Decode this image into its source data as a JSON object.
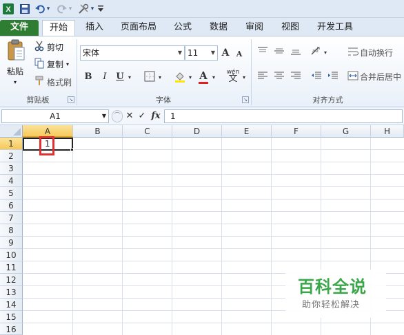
{
  "qat": {
    "excel_icon": "X",
    "undo_arrow": "▾",
    "redo_arrow": "▾",
    "customize": "₹"
  },
  "tabs": [
    "文件",
    "开始",
    "插入",
    "页面布局",
    "公式",
    "数据",
    "审阅",
    "视图",
    "开发工具"
  ],
  "ribbon": {
    "clipboard": {
      "paste": "粘贴",
      "cut": "剪切",
      "copy": "复制",
      "format_painter": "格式刷",
      "label": "剪贴板"
    },
    "font": {
      "name": "宋体",
      "size": "11",
      "grow": "A",
      "shrink": "A",
      "bold": "B",
      "italic": "I",
      "underline": "U",
      "font_color": "A",
      "wen": "wén",
      "label": "字体"
    },
    "alignment": {
      "wrap": "自动换行",
      "merge": "合并后居中",
      "label": "对齐方式"
    }
  },
  "formula_bar": {
    "name_box": "A1",
    "cancel": "✕",
    "enter": "✓",
    "fx": "fx",
    "value": "1"
  },
  "grid": {
    "columns": [
      "A",
      "B",
      "C",
      "D",
      "E",
      "F",
      "G",
      "H"
    ],
    "rows": [
      "1",
      "2",
      "3",
      "4",
      "5",
      "6",
      "7",
      "8",
      "9",
      "10",
      "11",
      "12",
      "13",
      "14",
      "15",
      "16"
    ],
    "cell_a1": "1"
  },
  "watermark": {
    "title": "百科全说",
    "subtitle": "助你轻松解决"
  },
  "colors": {
    "file_tab": "#2f7d32",
    "selection_header": "#f6c95a",
    "highlight_box": "#e03030",
    "watermark_green": "#3aa64a"
  }
}
